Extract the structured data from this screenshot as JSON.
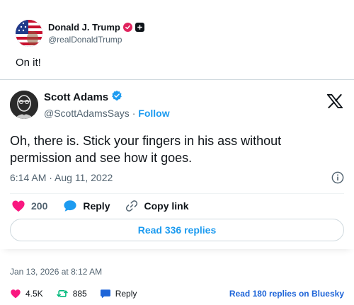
{
  "outer_post": {
    "author_name": "Donald J. Trump",
    "author_handle": "@realDonaldTrump",
    "text": "On it!"
  },
  "embedded_tweet": {
    "author_name": "Scott Adams",
    "author_handle": "@ScottAdamsSays",
    "separator": "·",
    "follow_label": "Follow",
    "text": "Oh, there is. Stick your fingers in his ass without permission and see how it goes.",
    "timestamp": "6:14 AM · Aug 11, 2022",
    "like_count": "200",
    "reply_label": "Reply",
    "copy_link_label": "Copy link",
    "read_replies_label": "Read 336 replies"
  },
  "bluesky_footer": {
    "date": "Jan 13, 2026 at 8:12 AM",
    "like_count": "4.5K",
    "repost_count": "885",
    "reply_label": "Reply",
    "read_replies_label": "Read 180 replies on Bluesky"
  },
  "colors": {
    "like": "#f91880",
    "reply": "#1d9bf0",
    "repost": "#00ba7c",
    "link": "#1d9bf0",
    "bluesky_link": "#1d64d8"
  },
  "icons": [
    "pink-check-icon",
    "plus-badge-icon",
    "verified-icon",
    "x-logo-icon",
    "info-icon",
    "heart-icon",
    "speech-bubble-icon",
    "link-icon",
    "repost-icon"
  ]
}
